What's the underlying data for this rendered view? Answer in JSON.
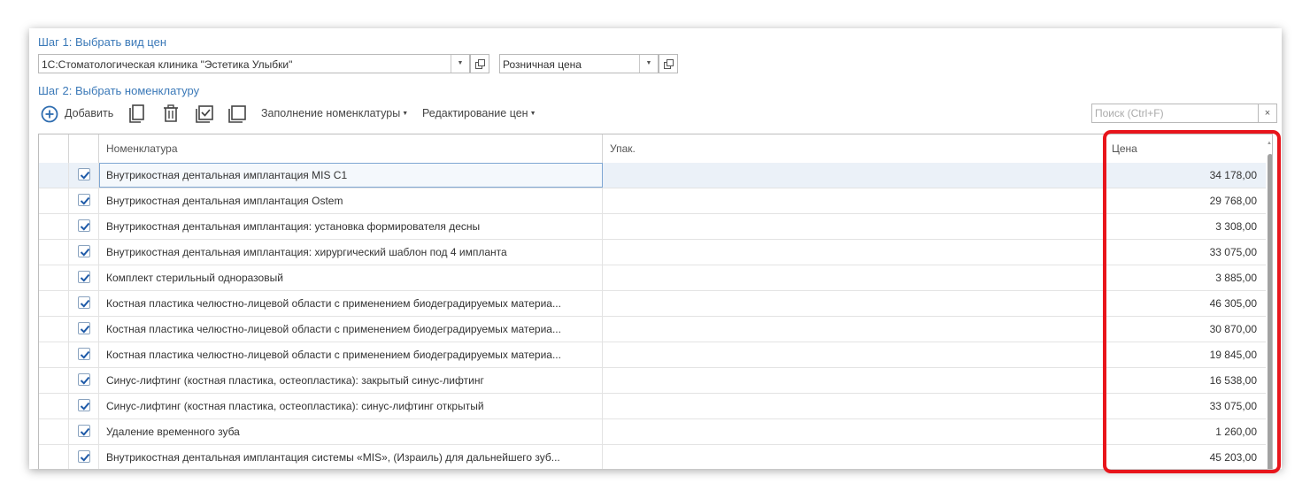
{
  "step1": {
    "title": "Шаг 1: Выбрать вид цен",
    "org_value": "1С:Стоматологическая клиника \"Эстетика Улыбки\"",
    "price_type_value": "Розничная цена"
  },
  "step2": {
    "title": "Шаг 2: Выбрать номенклатуру"
  },
  "toolbar": {
    "add_label": "Добавить",
    "fill_label": "Заполнение номенклатуры",
    "edit_prices_label": "Редактирование цен",
    "search_placeholder": "Поиск (Ctrl+F)",
    "search_clear": "×"
  },
  "table": {
    "headers": {
      "nomenclature": "Номенклатура",
      "package": "Упак.",
      "price": "Цена"
    },
    "rows": [
      {
        "name": "Внутрикостная дентальная имплантация MIS C1",
        "package": "",
        "price": "34 178,00",
        "checked": true
      },
      {
        "name": "Внутрикостная дентальная имплантация Ostem",
        "package": "",
        "price": "29 768,00",
        "checked": true
      },
      {
        "name": "Внутрикостная дентальная имплантация: установка формирователя десны",
        "package": "",
        "price": "3 308,00",
        "checked": true
      },
      {
        "name": "Внутрикостная дентальная имплантация: хирургический шаблон под 4 импланта",
        "package": "",
        "price": "33 075,00",
        "checked": true
      },
      {
        "name": "Комплект стерильный одноразовый",
        "package": "",
        "price": "3 885,00",
        "checked": true
      },
      {
        "name": "Костная пластика челюстно-лицевой области с применением биодеградируемых материа...",
        "package": "",
        "price": "46 305,00",
        "checked": true
      },
      {
        "name": "Костная пластика челюстно-лицевой области с применением биодеградируемых материа...",
        "package": "",
        "price": "30 870,00",
        "checked": true
      },
      {
        "name": "Костная пластика челюстно-лицевой области с применением биодеградируемых материа...",
        "package": "",
        "price": "19 845,00",
        "checked": true
      },
      {
        "name": "Синус-лифтинг (костная пластика, остеопластика): закрытый синус-лифтинг",
        "package": "",
        "price": "16 538,00",
        "checked": true
      },
      {
        "name": "Синус-лифтинг (костная пластика, остеопластика): синус-лифтинг открытый",
        "package": "",
        "price": "33 075,00",
        "checked": true
      },
      {
        "name": "Удаление временного зуба",
        "package": "",
        "price": "1 260,00",
        "checked": true
      },
      {
        "name": "Внутрикостная дентальная имплантация системы «MIS», (Израиль) для дальнейшего зуб...",
        "package": "",
        "price": "45 203,00",
        "checked": true
      }
    ]
  },
  "colors": {
    "accent": "#3b79b8",
    "highlight": "#e8151c",
    "selected_row": "#ebf1f8"
  }
}
